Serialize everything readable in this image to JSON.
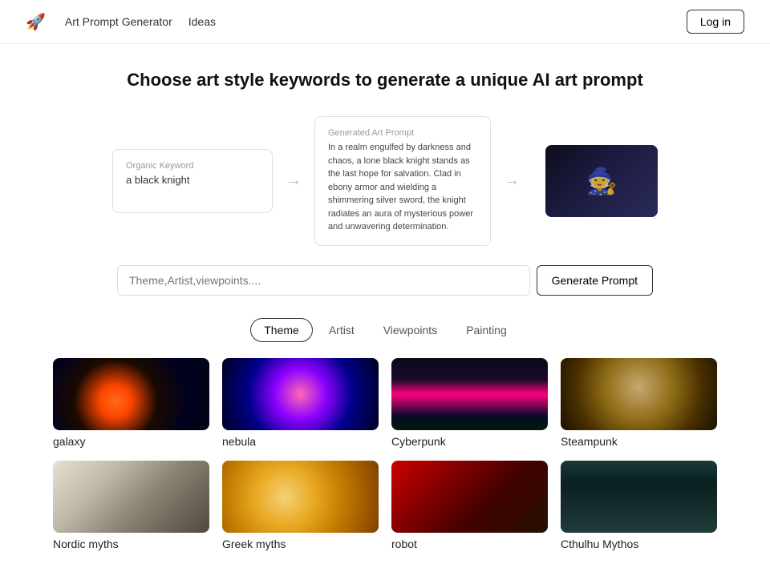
{
  "nav": {
    "logo_label": "🚀",
    "links": [
      "Art Prompt Generator",
      "Ideas"
    ],
    "login_label": "Log in"
  },
  "hero": {
    "title": "Choose art style keywords to generate a unique AI art prompt"
  },
  "demo": {
    "organic_label": "Organic Keyword",
    "organic_text": "a black knight",
    "generated_label": "Generated Art Prompt",
    "generated_text": "In a realm engulfed by darkness and chaos, a lone black knight stands as the last hope for salvation. Clad in ebony armor and wielding a shimmering silver sword, the knight radiates an aura of mysterious power and unwavering determination."
  },
  "search": {
    "placeholder": "Theme,Artist,viewpoints....",
    "button_label": "Generate Prompt"
  },
  "tabs": [
    {
      "id": "theme",
      "label": "Theme",
      "active": true
    },
    {
      "id": "artist",
      "label": "Artist",
      "active": false
    },
    {
      "id": "viewpoints",
      "label": "Viewpoints",
      "active": false
    },
    {
      "id": "painting",
      "label": "Painting",
      "active": false
    }
  ],
  "grid_items": [
    {
      "id": "galaxy",
      "label": "galaxy",
      "img_class": "img-galaxy"
    },
    {
      "id": "nebula",
      "label": "nebula",
      "img_class": "img-nebula"
    },
    {
      "id": "cyberpunk",
      "label": "Cyberpunk",
      "img_class": "img-cyberpunk"
    },
    {
      "id": "steampunk",
      "label": "Steampunk",
      "img_class": "img-steampunk"
    },
    {
      "id": "nordic",
      "label": "Nordic myths",
      "img_class": "img-nordic"
    },
    {
      "id": "greek",
      "label": "Greek myths",
      "img_class": "img-greek"
    },
    {
      "id": "robot",
      "label": "robot",
      "img_class": "img-robot"
    },
    {
      "id": "cthulhu",
      "label": "Cthulhu Mythos",
      "img_class": "img-cthulhu"
    }
  ]
}
